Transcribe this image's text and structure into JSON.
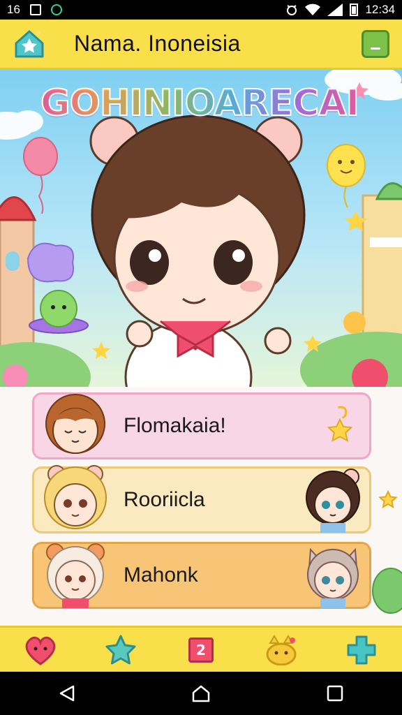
{
  "status_bar": {
    "left_text": "16",
    "time": "12:34"
  },
  "app_bar": {
    "title": "Nama. Inoneisia",
    "home_icon": "star-house-icon",
    "menu_icon": "minus-icon"
  },
  "banner": {
    "game_title": "GOHINIOARECAI"
  },
  "characters": [
    {
      "name": "Flomakaia!",
      "color": "#f8d6e5"
    },
    {
      "name": "Rooriicla",
      "color": "#fbe9bf"
    },
    {
      "name": "Mahonk",
      "color": "#f8c577"
    }
  ],
  "tabs": [
    {
      "icon": "heart-icon",
      "color": "#ef4f6d"
    },
    {
      "icon": "star-icon",
      "color": "#59c9c0"
    },
    {
      "icon": "number-two-icon",
      "label": "2",
      "color": "#ef4f6d"
    },
    {
      "icon": "cat-icon",
      "color": "#f6c93a"
    },
    {
      "icon": "puzzle-icon",
      "color": "#49c4c5"
    }
  ],
  "colors": {
    "accent_yellow": "#f9e04b",
    "sky_blue": "#7fd0f2"
  }
}
